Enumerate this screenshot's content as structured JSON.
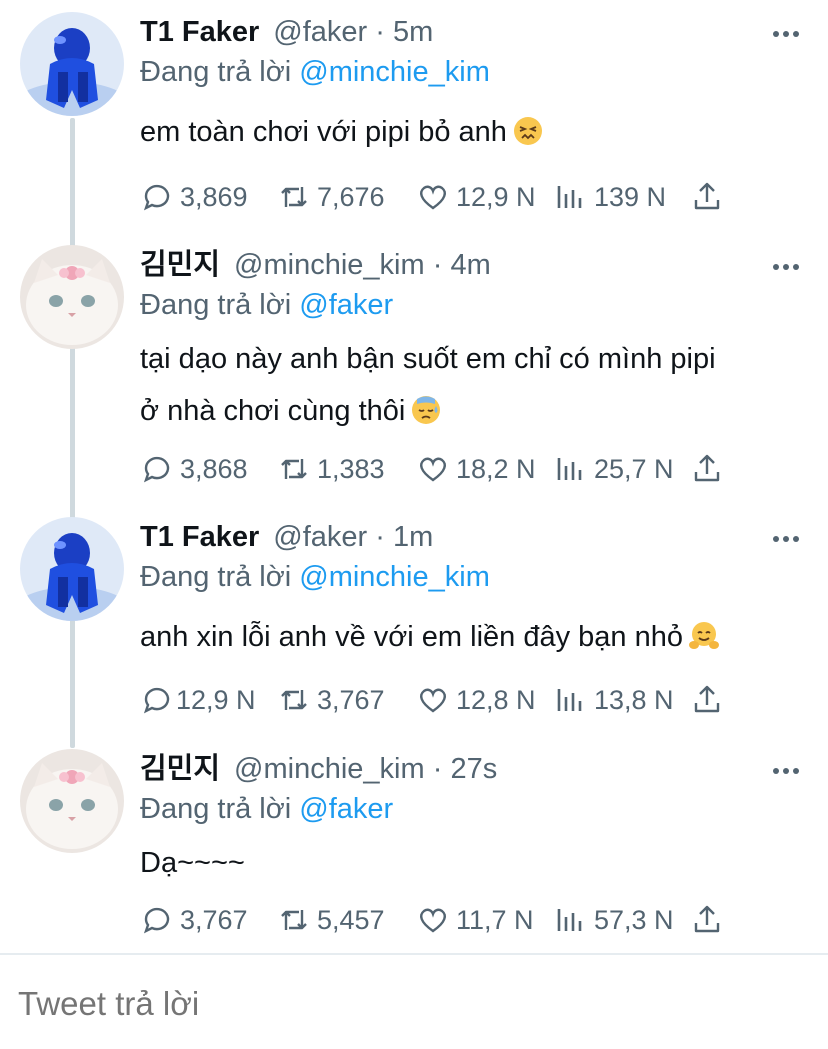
{
  "tweets": [
    {
      "name": "T1 Faker",
      "handle": "@faker",
      "dot": "·",
      "time": "5m",
      "reply_prefix": "Đang trả lời",
      "reply_to": "@minchie_kim",
      "lines": [
        "em toàn chơi với pipi bỏ anh"
      ],
      "emoji": "confounded-face",
      "avatar": "blue-figure",
      "stats": {
        "replies": "3,869",
        "retweets": "7,676",
        "likes": "12,9 N",
        "views": "139 N"
      }
    },
    {
      "name": "김민지",
      "handle": "@minchie_kim",
      "dot": "·",
      "time": "4m",
      "reply_prefix": "Đang trả lời",
      "reply_to": "@faker",
      "lines": [
        "tại dạo này anh bận suốt em chỉ có mình pipi",
        "ở nhà chơi cùng thôi"
      ],
      "emoji": "downcast-sweat-face",
      "avatar": "white-cat",
      "stats": {
        "replies": "3,868",
        "retweets": "1,383",
        "likes": "18,2 N",
        "views": "25,7 N"
      }
    },
    {
      "name": "T1 Faker",
      "handle": "@faker",
      "dot": "·",
      "time": "1m",
      "reply_prefix": "Đang trả lời",
      "reply_to": "@minchie_kim",
      "lines": [
        "anh xin lỗi anh về với em liền đây bạn nhỏ"
      ],
      "emoji": "hugging-face",
      "avatar": "blue-figure",
      "stats": {
        "replies": "12,9 N",
        "retweets": "3,767",
        "likes": "12,8 N",
        "views": "13,8 N"
      }
    },
    {
      "name": "김민지",
      "handle": "@minchie_kim",
      "dot": "·",
      "time": "27s",
      "reply_prefix": "Đang trả lời",
      "reply_to": "@faker",
      "lines": [
        "Dạ~~~~"
      ],
      "emoji": "",
      "avatar": "white-cat",
      "stats": {
        "replies": "3,767",
        "retweets": "5,457",
        "likes": "11,7 N",
        "views": "57,3 N"
      }
    }
  ],
  "compose": {
    "placeholder": "Tweet trả lời"
  },
  "colors": {
    "text": "#0f1419",
    "muted": "#536471",
    "link": "#1d9bf0",
    "divider": "#e6ecf0",
    "thread_line": "#cfd9de"
  }
}
